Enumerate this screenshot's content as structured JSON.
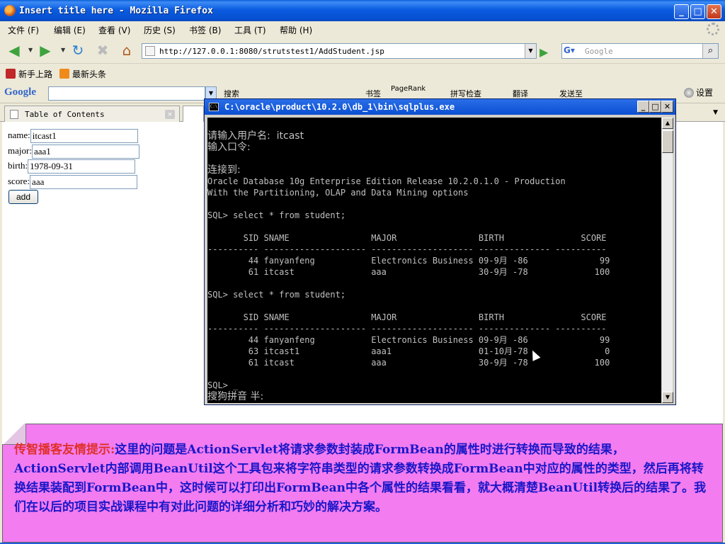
{
  "browser": {
    "title": "Insert title here - Mozilla Firefox",
    "menu": [
      "文件 (F)",
      "编辑 (E)",
      "查看 (V)",
      "历史 (S)",
      "书签 (B)",
      "工具 (T)",
      "帮助 (H)"
    ],
    "url": "http://127.0.0.1:8080/strutstest1/AddStudent.jsp",
    "search_placeholder": "Google",
    "bookmarks": [
      "新手上路",
      "最新头条"
    ],
    "google_toolbar": {
      "logo": "Google",
      "items": [
        "搜索",
        "书签",
        "PageRank",
        "拼写检查",
        "翻译",
        "发送至"
      ],
      "settings": "设置"
    },
    "tab_label": "Table of Contents"
  },
  "form": {
    "name_label": "name:",
    "name_value": "itcast1",
    "major_label": "major:",
    "major_value": "aaa1",
    "birth_label": "birth:",
    "birth_value": "1978-09-31",
    "score_label": "score:",
    "score_value": "aaa",
    "add_label": "add"
  },
  "console": {
    "title": "C:\\oracle\\product\\10.2.0\\db_1\\bin\\sqlplus.exe",
    "lines": [
      "",
      "请输入用户名:  itcast",
      "输入口令:",
      "",
      "连接到:",
      "Oracle Database 10g Enterprise Edition Release 10.2.0.1.0 - Production",
      "With the Partitioning, OLAP and Data Mining options",
      "",
      "SQL> select * from student;",
      "",
      "       SID SNAME                MAJOR                BIRTH               SCORE",
      "---------- -------------------- -------------------- -------------- ----------",
      "        44 fanyanfeng           Electronics Business 09-9月 -86              99",
      "        61 itcast               aaa                  30-9月 -78             100",
      "",
      "SQL> select * from student;",
      "",
      "       SID SNAME                MAJOR                BIRTH               SCORE",
      "---------- -------------------- -------------------- -------------- ----------",
      "        44 fanyanfeng           Electronics Business 09-9月 -86              99",
      "        63 itcast1              aaa1                 01-10月-78               0",
      "        61 itcast               aaa                  30-9月 -78             100",
      "",
      "SQL> _",
      "搜狗拼音 半:"
    ]
  },
  "tip": {
    "label": "传智播客友情提示:",
    "text": "这里的问题是ActionServlet将请求参数封装成FormBean的属性时进行转换而导致的结果，ActionServlet内部调用BeanUtil这个工具包来将字符串类型的请求参数转换成FormBean中对应的属性的类型，然后再将转换结果装配到FormBean中，这时候可以打印出FormBean中各个属性的结果看看，就大概清楚BeanUtil转换后的结果了。我们在以后的项目实战课程中有对此问题的详细分析和巧妙的解决方案。"
  }
}
